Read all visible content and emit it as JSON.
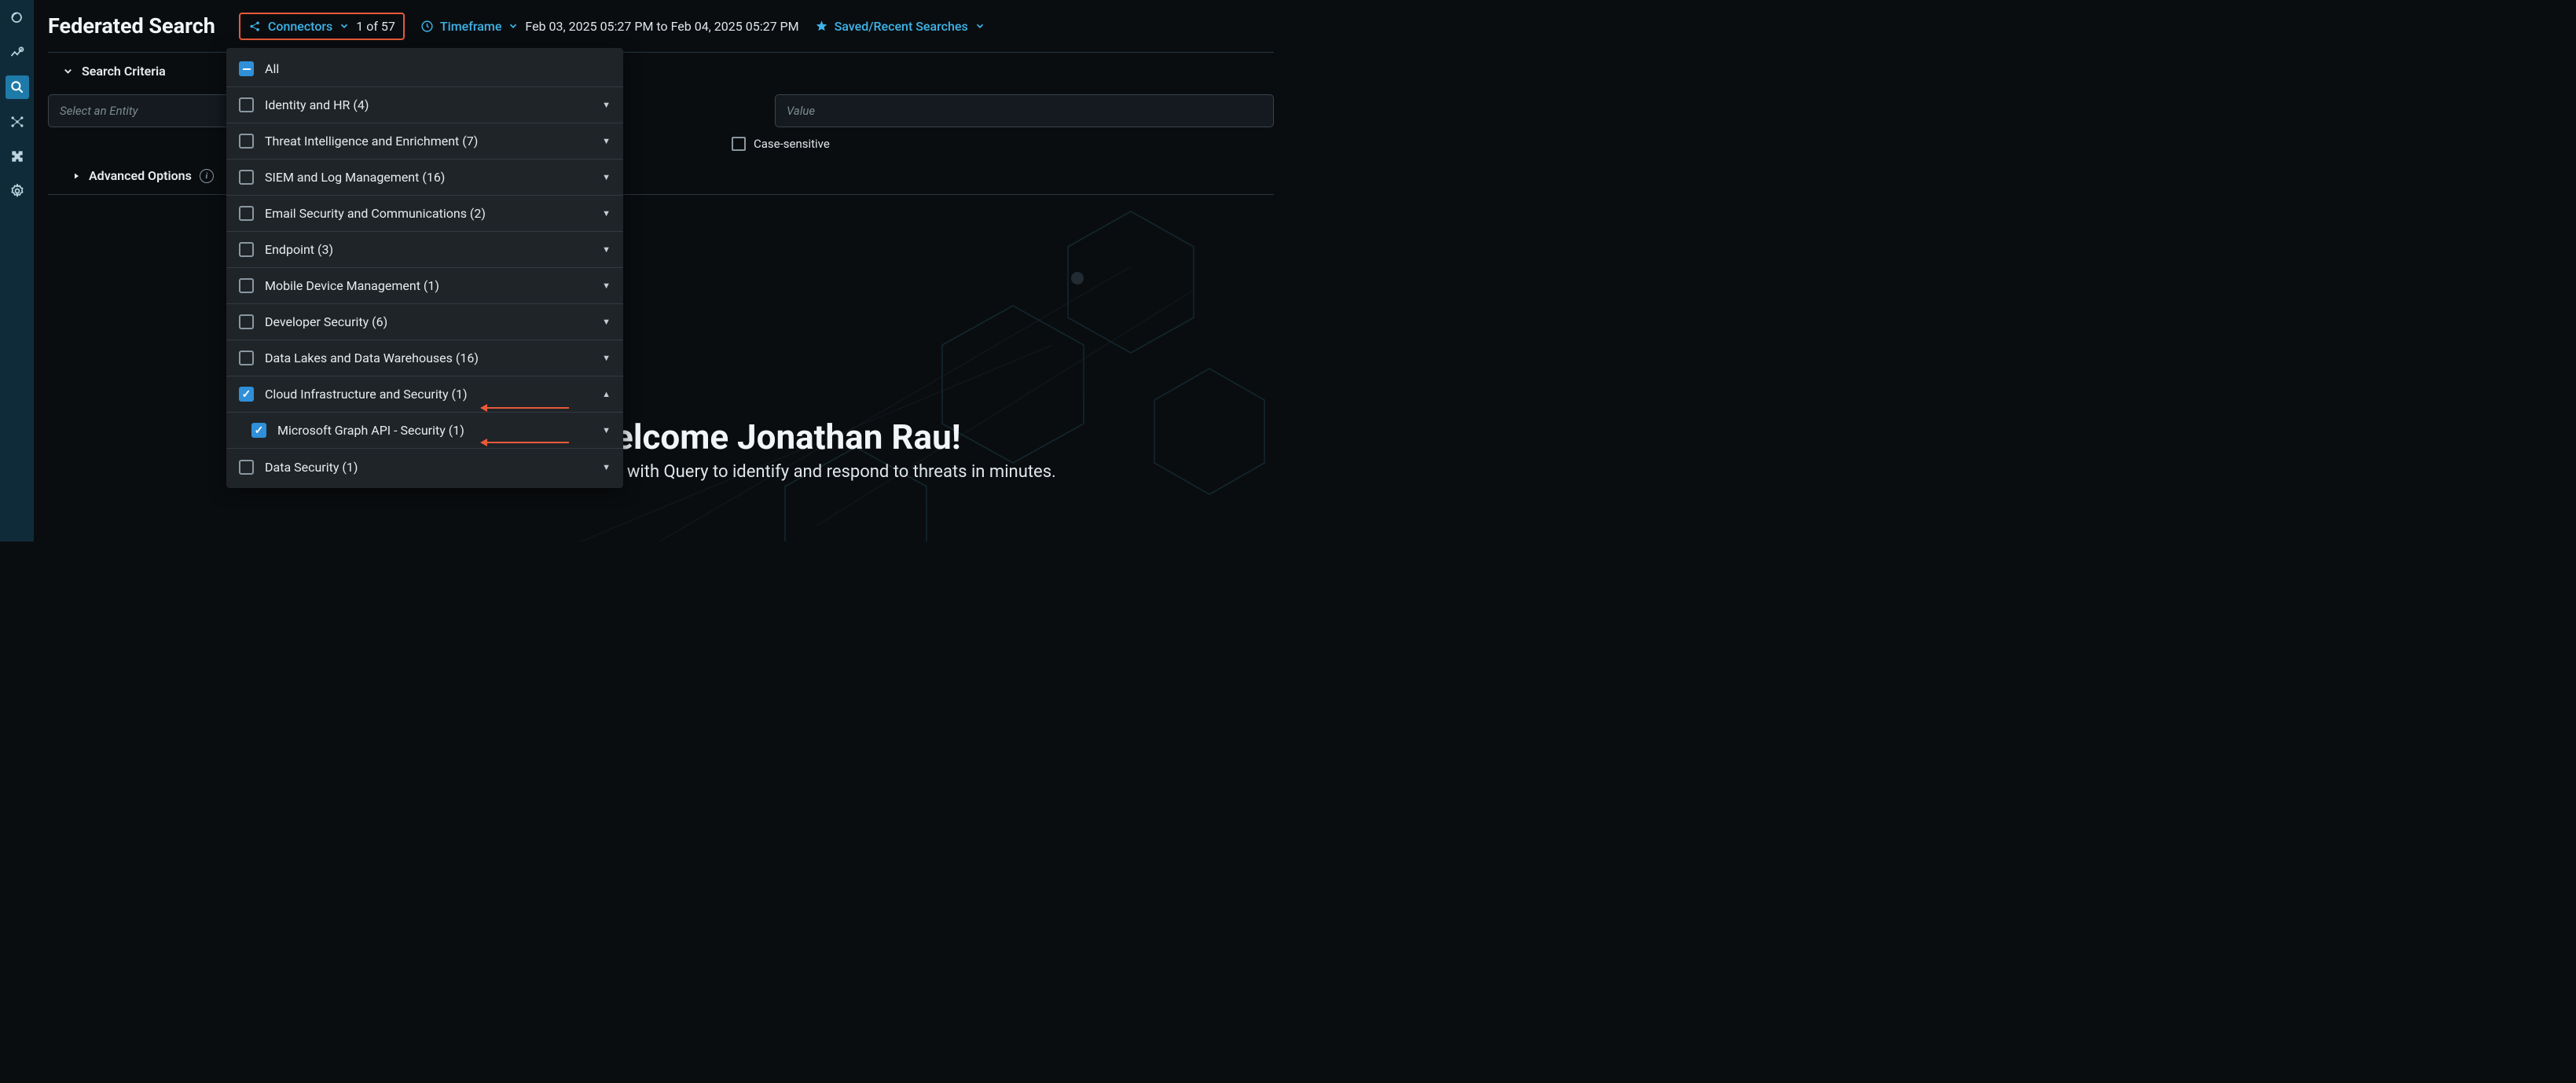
{
  "page_title": "Federated Search",
  "toolbar": {
    "connectors_label": "Connectors",
    "connectors_count": "1 of 57",
    "timeframe_label": "Timeframe",
    "timeframe_value": "Feb 03, 2025 05:27 PM to Feb 04, 2025 05:27 PM",
    "saved_label": "Saved/Recent Searches"
  },
  "criteria": {
    "header": "Search Criteria",
    "entity_placeholder": "Select an Entity",
    "value_placeholder": "Value",
    "case_label": "Case-sensitive",
    "advanced_label": "Advanced Options"
  },
  "welcome": {
    "title": "Welcome Jonathan Rau!",
    "subtitle": "Explore your data with Query to identify and respond to threats in minutes."
  },
  "dropdown": {
    "all_label": "All",
    "items": [
      {
        "label": "Identity and HR (4)",
        "checked": false,
        "expanded": false
      },
      {
        "label": "Threat Intelligence and Enrichment (7)",
        "checked": false,
        "expanded": false
      },
      {
        "label": "SIEM and Log Management (16)",
        "checked": false,
        "expanded": false
      },
      {
        "label": "Email Security and Communications (2)",
        "checked": false,
        "expanded": false
      },
      {
        "label": "Endpoint (3)",
        "checked": false,
        "expanded": false
      },
      {
        "label": "Mobile Device Management (1)",
        "checked": false,
        "expanded": false
      },
      {
        "label": "Developer Security (6)",
        "checked": false,
        "expanded": false
      },
      {
        "label": "Data Lakes and Data Warehouses (16)",
        "checked": false,
        "expanded": false
      },
      {
        "label": "Cloud Infrastructure and Security (1)",
        "checked": true,
        "expanded": true
      },
      {
        "label": "Microsoft Graph API - Security (1)",
        "checked": true,
        "child": true,
        "expanded": false
      },
      {
        "label": "Data Security (1)",
        "checked": false,
        "expanded": false
      }
    ]
  },
  "sidebar_icons": [
    "logo",
    "analytics",
    "search",
    "graph",
    "puzzle",
    "settings"
  ]
}
